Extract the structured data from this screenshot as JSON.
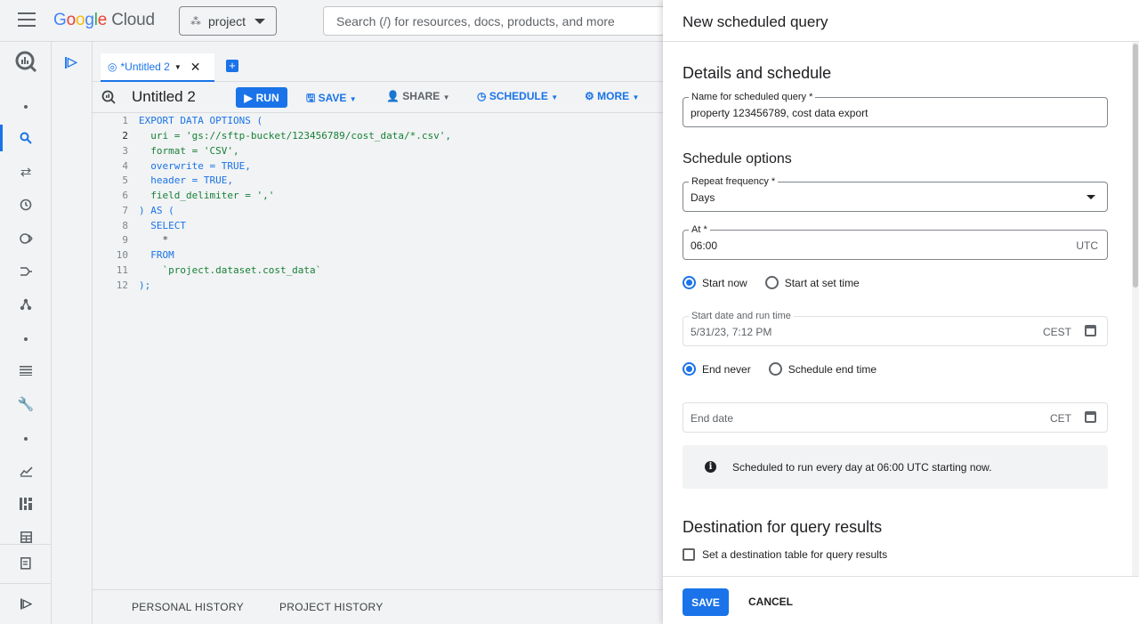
{
  "header": {
    "logo_google": "Google",
    "logo_cloud": "Cloud",
    "project_label": "project",
    "search_placeholder": "Search (/) for resources, docs, products, and more"
  },
  "rail": {
    "icons": [
      "bigquery-icon",
      "dot",
      "search-icon",
      "transfer-icon",
      "history-icon",
      "scheduled-icon",
      "dataflow-icon",
      "hierarchy-icon",
      "dot",
      "list-icon",
      "wrench-icon",
      "dot",
      "analytics-icon",
      "dashboard-icon",
      "table-icon",
      "notes-icon",
      "expand-icon"
    ]
  },
  "editor": {
    "tab_label": "*Untitled 2",
    "query_title": "Untitled 2",
    "toolbar": {
      "run": "RUN",
      "save": "SAVE",
      "share": "SHARE",
      "schedule": "SCHEDULE",
      "more": "MORE"
    },
    "lines": [
      "EXPORT DATA OPTIONS (",
      "  uri = 'gs://sftp-bucket/123456789/cost_data/*.csv',",
      "  format = 'CSV',",
      "  overwrite = TRUE,",
      "  header = TRUE,",
      "  field_delimiter = ','",
      ") AS (",
      "  SELECT",
      "    *",
      "  FROM",
      "    `project.dataset.cost_data`",
      ");"
    ],
    "line_numbers": [
      "1",
      "2",
      "3",
      "4",
      "5",
      "6",
      "7",
      "8",
      "9",
      "10",
      "11",
      "12"
    ],
    "history_tabs": [
      "PERSONAL HISTORY",
      "PROJECT HISTORY"
    ]
  },
  "panel": {
    "title": "New scheduled query",
    "details_title": "Details and schedule",
    "name_label": "Name for scheduled query *",
    "name_value": "property 123456789, cost data export",
    "schedule_title": "Schedule options",
    "repeat_label": "Repeat frequency *",
    "repeat_value": "Days",
    "at_label": "At *",
    "at_value": "06:00",
    "at_suffix": "UTC",
    "start_now": "Start now",
    "start_set": "Start at set time",
    "start_date_label": "Start date and run time",
    "start_date_value": "5/31/23, 7:12 PM",
    "start_tz": "CEST",
    "end_never": "End never",
    "end_schedule": "Schedule end time",
    "end_date_placeholder": "End date",
    "end_tz": "CET",
    "info_text": "Scheduled to run every day at 06:00 UTC starting now.",
    "destination_title": "Destination for query results",
    "destination_checkbox": "Set a destination table for query results",
    "save": "SAVE",
    "cancel": "CANCEL"
  }
}
